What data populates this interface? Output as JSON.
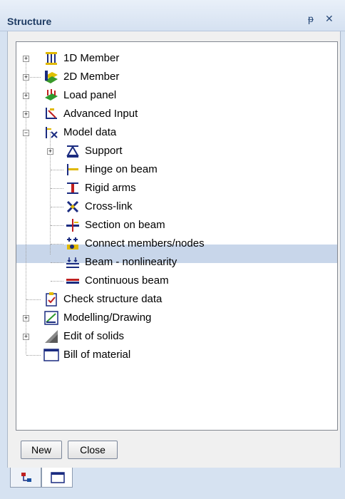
{
  "window": {
    "title": "Structure",
    "pin_glyph": "ᵽ",
    "close_glyph": "✕"
  },
  "tree": {
    "items": [
      {
        "label": "1D Member",
        "icon": "1d-member-icon",
        "expander": "+"
      },
      {
        "label": "2D Member",
        "icon": "2d-member-icon",
        "expander": "+"
      },
      {
        "label": "Load panel",
        "icon": "load-panel-icon",
        "expander": "+"
      },
      {
        "label": "Advanced Input",
        "icon": "advanced-input-icon",
        "expander": "+"
      },
      {
        "label": "Model data",
        "icon": "model-data-icon",
        "expander": "−"
      },
      {
        "label": "Support",
        "icon": "support-icon",
        "expander": "+"
      },
      {
        "label": "Hinge on beam",
        "icon": "hinge-icon"
      },
      {
        "label": "Rigid arms",
        "icon": "rigid-arms-icon"
      },
      {
        "label": "Cross-link",
        "icon": "cross-link-icon"
      },
      {
        "label": "Section on beam",
        "icon": "section-icon"
      },
      {
        "label": "Connect members/nodes",
        "icon": "connect-icon"
      },
      {
        "label": "Beam - nonlinearity",
        "icon": "nonlinearity-icon",
        "selected": true
      },
      {
        "label": "Continuous beam",
        "icon": "continuous-beam-icon"
      },
      {
        "label": "Check structure data",
        "icon": "check-data-icon"
      },
      {
        "label": "Modelling/Drawing",
        "icon": "modelling-icon",
        "expander": "+"
      },
      {
        "label": "Edit of solids",
        "icon": "solids-icon",
        "expander": "+"
      },
      {
        "label": "Bill of material",
        "icon": "bill-icon"
      }
    ]
  },
  "buttons": {
    "new_label": "New",
    "close_label": "Close"
  },
  "colors": {
    "selection": "#c8d6ea",
    "accent": "#1e3b63"
  }
}
